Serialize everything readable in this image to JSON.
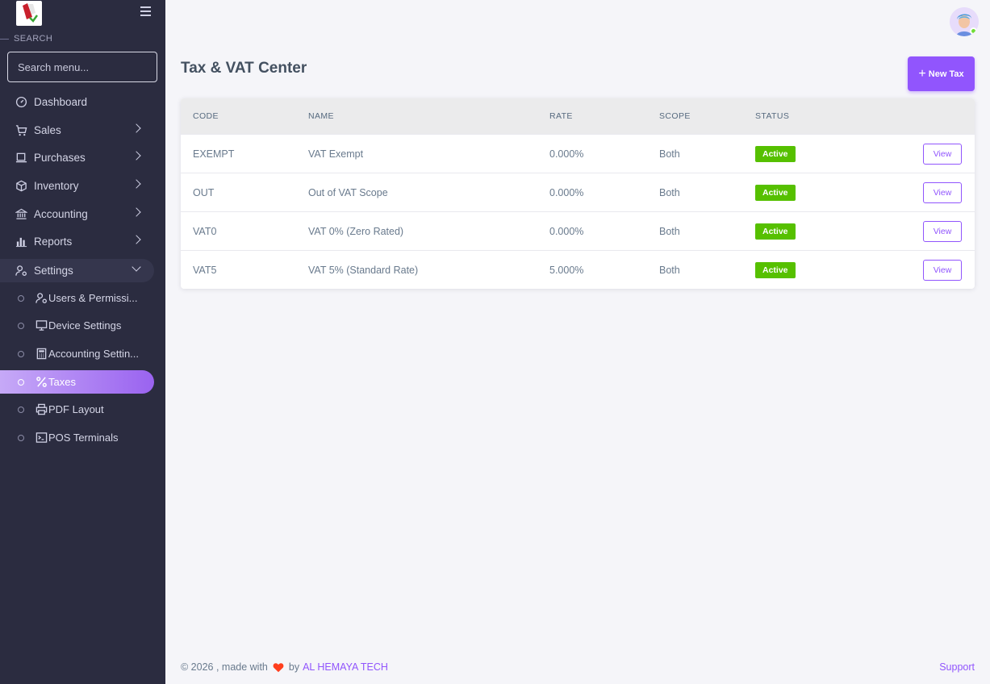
{
  "sidebar": {
    "search_heading": "SEARCH",
    "search_placeholder": "Search menu...",
    "items": [
      {
        "label": "Dashboard",
        "icon": "dashboard-icon"
      },
      {
        "label": "Sales",
        "icon": "cart-icon"
      },
      {
        "label": "Purchases",
        "icon": "laptop-icon"
      },
      {
        "label": "Inventory",
        "icon": "box-icon"
      },
      {
        "label": "Accounting",
        "icon": "bank-icon"
      },
      {
        "label": "Reports",
        "icon": "bar-chart-icon"
      },
      {
        "label": "Settings",
        "icon": "user-cog-icon"
      }
    ],
    "settings_sub": [
      {
        "label": "Users & Permissi...",
        "icon": "user-cog-icon"
      },
      {
        "label": "Device Settings",
        "icon": "monitor-icon"
      },
      {
        "label": "Accounting Settin...",
        "icon": "calculator-icon"
      },
      {
        "label": "Taxes",
        "icon": "percent-icon"
      },
      {
        "label": "PDF Layout",
        "icon": "printer-icon"
      },
      {
        "label": "POS Terminals",
        "icon": "terminal-icon"
      }
    ]
  },
  "header": {
    "title": "Tax & VAT Center",
    "new_button": "New Tax"
  },
  "table": {
    "columns": [
      "CODE",
      "NAME",
      "RATE",
      "SCOPE",
      "STATUS"
    ],
    "rows": [
      {
        "code": "EXEMPT",
        "name": "VAT Exempt",
        "rate": "0.000%",
        "scope": "Both",
        "status": "Active",
        "action": "View"
      },
      {
        "code": "OUT",
        "name": "Out of VAT Scope",
        "rate": "0.000%",
        "scope": "Both",
        "status": "Active",
        "action": "View"
      },
      {
        "code": "VAT0",
        "name": "VAT 0% (Zero Rated)",
        "rate": "0.000%",
        "scope": "Both",
        "status": "Active",
        "action": "View"
      },
      {
        "code": "VAT5",
        "name": "VAT 5% (Standard Rate)",
        "rate": "5.000%",
        "scope": "Both",
        "status": "Active",
        "action": "View"
      }
    ]
  },
  "footer": {
    "prefix": "© 2026 , made with",
    "by": "by",
    "company": "AL HEMAYA TECH",
    "support": "Support"
  },
  "colors": {
    "accent": "#9155fd",
    "sidebar_bg": "#2b2c40",
    "active_badge": "#56c000"
  }
}
